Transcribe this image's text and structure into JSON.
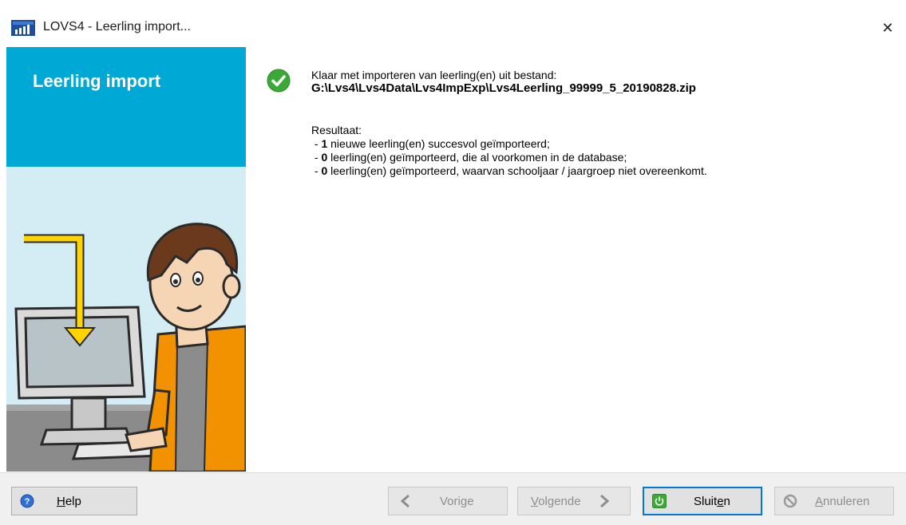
{
  "window": {
    "title": "LOVS4 - Leerling import...",
    "app_icon": "lovs-app-icon",
    "close_icon": "close-icon",
    "close_glyph": "✕"
  },
  "side_panel": {
    "title": "Leerling import",
    "illustration": "person-at-computer-import-illustration"
  },
  "message": {
    "status_icon": "check-circle-icon",
    "heading": "Klaar met importeren van leerling(en) uit bestand:",
    "file_path": "G:\\Lvs4\\Lvs4Data\\Lvs4ImpExp\\Lvs4Leerling_99999_5_20190828.zip",
    "result_label": "Resultaat:",
    "results": [
      {
        "prefix": " - ",
        "count": "1",
        "text": " nieuwe leerling(en) succesvol geïmporteerd;"
      },
      {
        "prefix": " - ",
        "count": "0",
        "text": " leerling(en) geïmporteerd, die al voorkomen in de database;"
      },
      {
        "prefix": " - ",
        "count": "0",
        "text": " leerling(en) geïmporteerd, waarvan schooljaar / jaargroep niet overeenkomt."
      }
    ]
  },
  "buttons": {
    "help": {
      "label_u": "H",
      "label_rest": "elp",
      "icon": "help-icon",
      "enabled": true
    },
    "prev": {
      "label": "Vorige",
      "icon": "chevron-left-icon",
      "enabled": false
    },
    "next": {
      "label_u": "V",
      "label_rest": "olgende",
      "icon": "chevron-right-icon",
      "enabled": false
    },
    "close": {
      "label_pre": "Sluit",
      "label_u": "e",
      "label_rest": "n",
      "icon": "power-icon",
      "enabled": true,
      "default": true
    },
    "cancel": {
      "label_u": "A",
      "label_rest": "nnuleren",
      "icon": "cancel-icon",
      "enabled": false
    }
  },
  "colors": {
    "panel_bg": "#00a8d6",
    "check_green": "#3aa935",
    "accent_border": "#0078d7",
    "arrow_yellow": "#ffd400",
    "shirt_orange": "#f39200"
  }
}
